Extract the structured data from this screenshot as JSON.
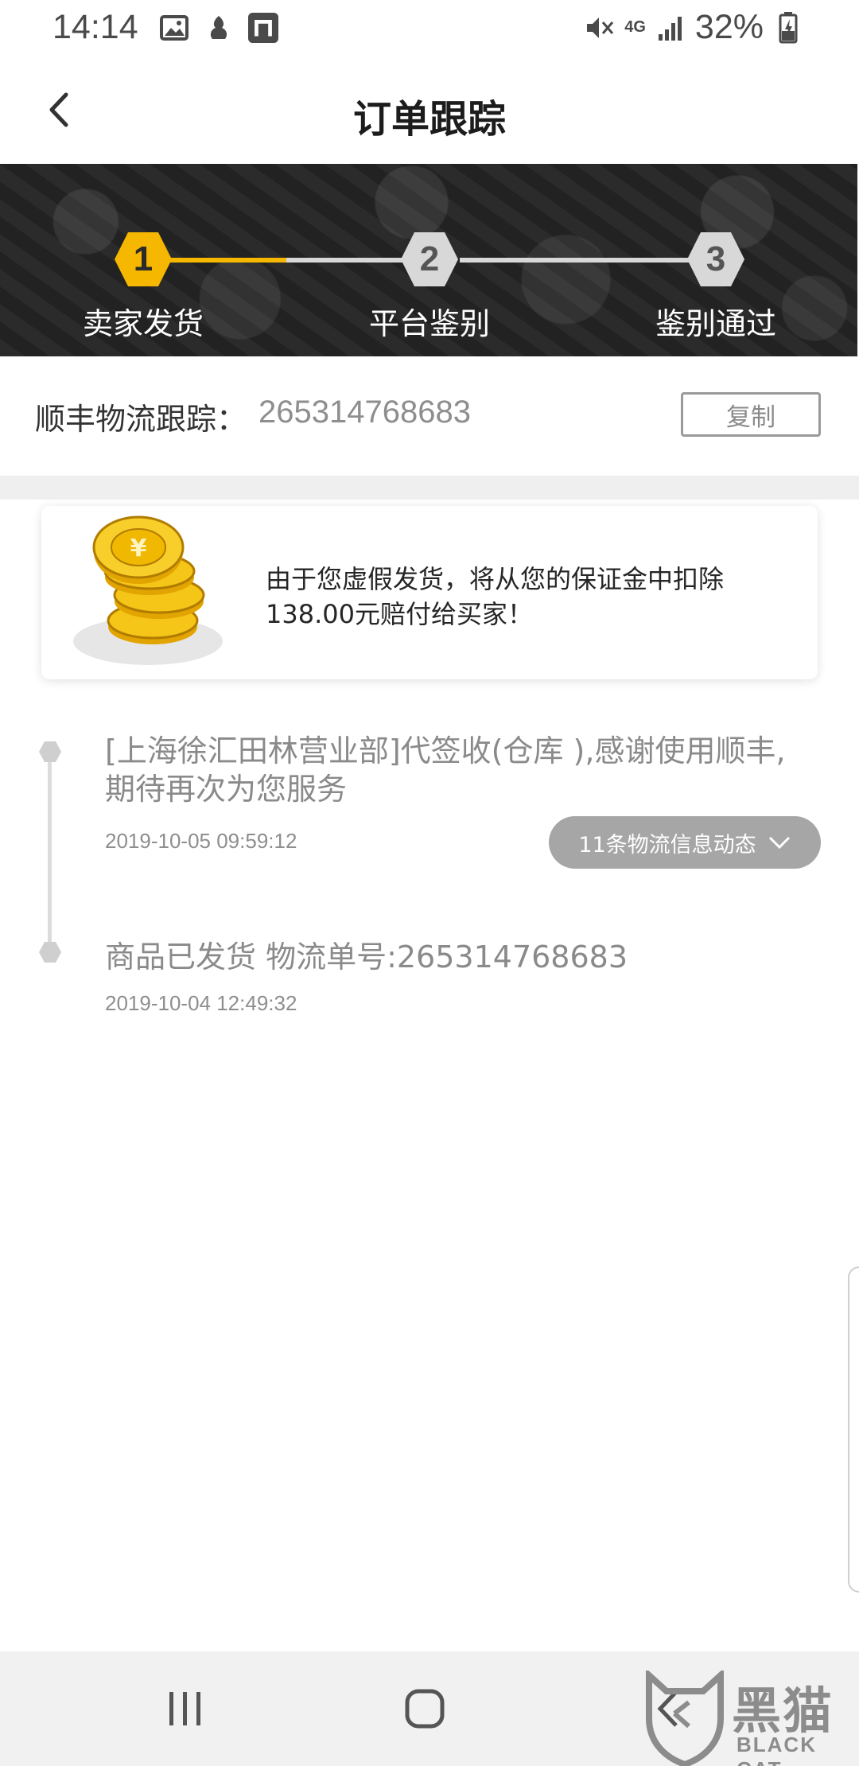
{
  "status_bar": {
    "time": "14:14",
    "network": "4G",
    "battery": "32%"
  },
  "header": {
    "title": "订单跟踪"
  },
  "steps": [
    {
      "number": "1",
      "label": "卖家发货",
      "active": true
    },
    {
      "number": "2",
      "label": "平台鉴别",
      "active": false
    },
    {
      "number": "3",
      "label": "鉴别通过",
      "active": false
    }
  ],
  "tracking": {
    "label": "顺丰物流跟踪：",
    "number": "265314768683",
    "copy_label": "复制"
  },
  "notice": {
    "line1": "由于您虚假发货，将从您的保证金中扣除",
    "line2": "138.00元赔付给买家！"
  },
  "timeline": [
    {
      "text_line1": "[上海徐汇田林营业部]代签收(仓库 ),感谢使用顺丰,",
      "text_line2": "期待再次为您服务",
      "time": "2019-10-05 09:59:12"
    },
    {
      "text_line1": "商品已发货 物流单号:265314768683",
      "time": "2019-10-04 12:49:32"
    }
  ],
  "logistics_button": {
    "label": "11条物流信息动态"
  },
  "watermark": {
    "cn": "黑猫",
    "en": "BLACK CAT"
  },
  "colors": {
    "accent": "#f5b700",
    "inactive_step": "#d8d8d8",
    "pill": "#a6a6a6"
  }
}
